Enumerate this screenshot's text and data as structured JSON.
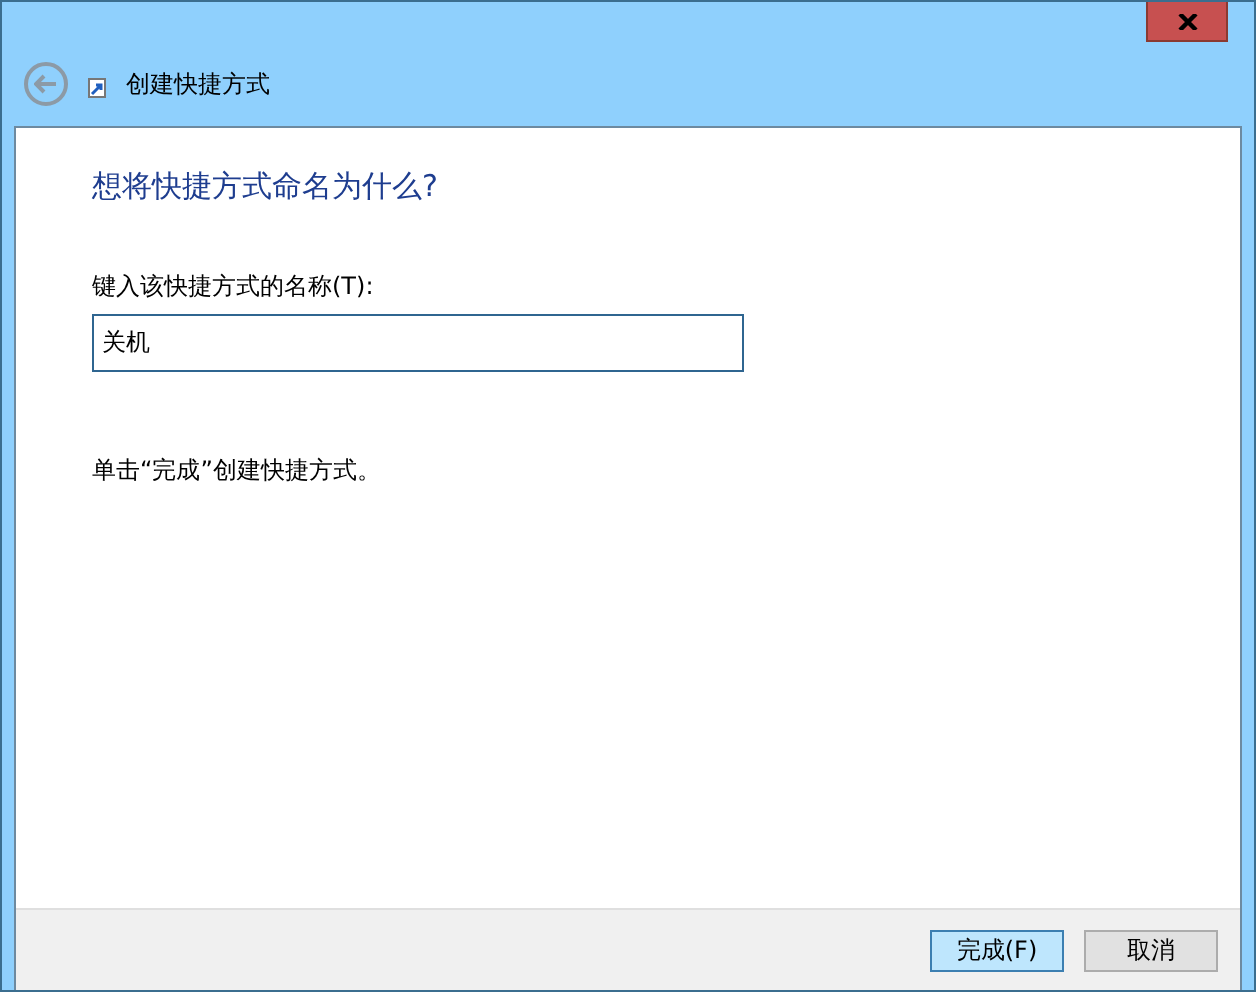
{
  "window": {
    "title": "创建快捷方式"
  },
  "heading": "想将快捷方式命名为什么?",
  "name_field": {
    "label": "键入该快捷方式的名称(T):",
    "value": "关机"
  },
  "hint": "单击“完成”创建快捷方式。",
  "buttons": [
    {
      "label": "完成(F)",
      "default": true
    },
    {
      "label": "取消",
      "default": false
    }
  ]
}
